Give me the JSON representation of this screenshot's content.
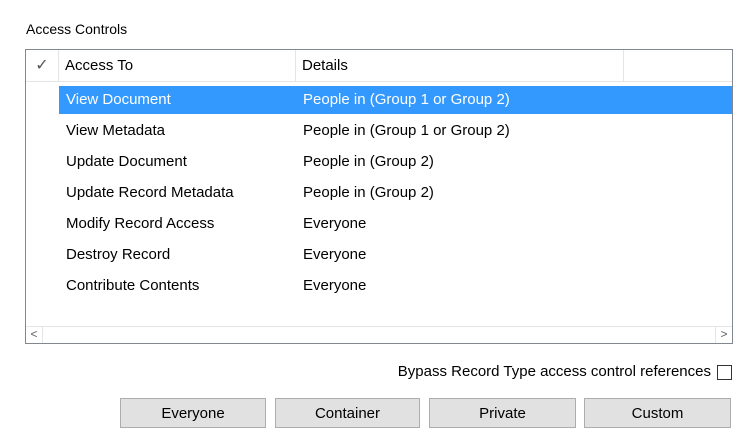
{
  "section_label": "Access Controls",
  "list": {
    "columns": {
      "check": "✓",
      "access_to": "Access To",
      "details": "Details"
    },
    "rows": [
      {
        "access_to": "View Document",
        "details": "People in (Group 1 or Group 2)",
        "selected": true
      },
      {
        "access_to": "View Metadata",
        "details": "People in (Group 1 or Group 2)",
        "selected": false
      },
      {
        "access_to": "Update Document",
        "details": "People in (Group 2)",
        "selected": false
      },
      {
        "access_to": "Update Record Metadata",
        "details": "People in (Group 2)",
        "selected": false
      },
      {
        "access_to": "Modify Record Access",
        "details": "Everyone",
        "selected": false
      },
      {
        "access_to": "Destroy Record",
        "details": "Everyone",
        "selected": false
      },
      {
        "access_to": "Contribute Contents",
        "details": "Everyone",
        "selected": false
      }
    ],
    "scroll_left_icon": "chevron-left-icon",
    "scroll_right_icon": "chevron-right-icon"
  },
  "bypass": {
    "label": "Bypass Record Type access control references",
    "checked": false
  },
  "buttons": {
    "everyone": "Everyone",
    "container": "Container",
    "private": "Private",
    "custom": "Custom"
  },
  "colors": {
    "selection": "#3399ff",
    "button_face": "#e1e1e1",
    "border": "#828790"
  }
}
